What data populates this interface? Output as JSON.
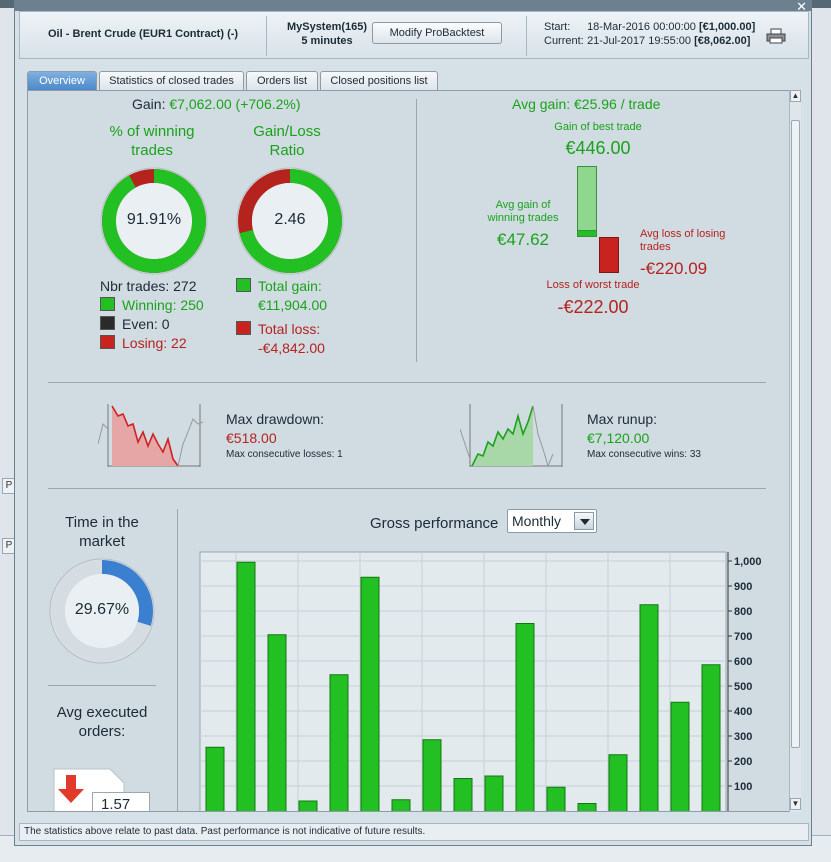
{
  "window": {
    "instrument": "Oil - Brent Crude (EUR1 Contract) (-)",
    "system": "MySystem(165)",
    "timeframe": "5 minutes",
    "modify_button": "Modify ProBacktest",
    "start_label": "Start:",
    "start_date": "18-Mar-2016 00:00:00",
    "start_value": "[€1,000.00]",
    "current_label": "Current:",
    "current_date": "21-Jul-2017 19:55:00",
    "current_value": "[€8,062.00]"
  },
  "tabs": [
    "Overview",
    "Statistics of closed trades",
    "Orders list",
    "Closed positions list"
  ],
  "summary": {
    "gain_label": "Gain:",
    "gain_value": "€7,062.00 (+706.2%)",
    "winning_title": "% of winning trades",
    "winning_pct": "91.91%",
    "winning_fraction": 0.9191,
    "ratio_title": "Gain/Loss Ratio",
    "ratio_value": "2.46",
    "ratio_gain_fraction": 0.711,
    "nbr_trades": "Nbr trades: 272",
    "winning": "Winning: 250",
    "even": "Even: 0",
    "losing": "Losing: 22",
    "total_gain_label": "Total gain:",
    "total_gain": "€11,904.00",
    "total_loss_label": "Total loss:",
    "total_loss": "-€4,842.00"
  },
  "avg": {
    "title": "Avg gain: €25.96 / trade",
    "best_label": "Gain of best trade",
    "best_value": "€446.00",
    "avg_win_label": "Avg gain of winning trades",
    "avg_win_value": "€47.62",
    "avg_loss_label": "Avg loss of losing trades",
    "avg_loss_value": "-€220.09",
    "worst_label": "Loss of worst trade",
    "worst_value": "-€222.00"
  },
  "drawdown": {
    "title": "Max drawdown:",
    "value": "€518.00",
    "consec": "Max consecutive losses: 1"
  },
  "runup": {
    "title": "Max runup:",
    "value": "€7,120.00",
    "consec": "Max consecutive wins: 33"
  },
  "market": {
    "title": "Time in the market",
    "value": "29.67%",
    "fraction": 0.2967,
    "orders_title": "Avg executed orders:",
    "orders_value": "1.57"
  },
  "performance": {
    "title": "Gross performance",
    "period": "Monthly"
  },
  "chart_data": {
    "type": "bar",
    "title": "Gross performance",
    "ylim": [
      0,
      1000
    ],
    "yticks": [
      100,
      200,
      300,
      400,
      500,
      600,
      700,
      800,
      900,
      1000
    ],
    "ytick_labels": [
      "100",
      "200",
      "300",
      "400",
      "500",
      "600",
      "700",
      "800",
      "900",
      "1,000"
    ],
    "values": [
      255,
      995,
      705,
      40,
      545,
      935,
      45,
      285,
      130,
      140,
      750,
      95,
      30,
      225,
      825,
      435,
      585
    ],
    "color": "#22c022"
  },
  "disclaimer": "The statistics above relate to past data. Past performance is not indicative of future results.",
  "colors": {
    "green": "#1aa31a",
    "red": "#b5231f"
  }
}
